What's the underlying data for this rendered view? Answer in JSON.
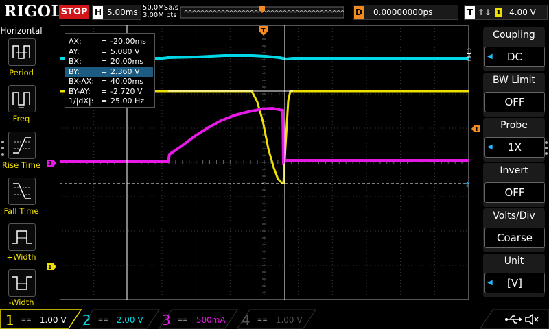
{
  "header": {
    "logo": "RIGOL",
    "run_state": "STOP",
    "timebase_tag": "H",
    "timebase": "5.00ms",
    "sample_rate": "50.0MSa/s",
    "memory_depth": "3.00M pts",
    "delay_tag": "D",
    "delay": "0.00000000ps",
    "trigger_tag": "T",
    "trigger_edge": "↑↓",
    "trigger_source": "1",
    "trigger_level": "4.00 V"
  },
  "left_menu": {
    "title": "Horizontal",
    "items": [
      {
        "label": "Period"
      },
      {
        "label": "Freq"
      },
      {
        "label": "Rise Time"
      },
      {
        "label": "Fall Time"
      },
      {
        "label": "+Width"
      },
      {
        "label": "-Width"
      }
    ]
  },
  "cursor_panel": {
    "rows": [
      {
        "key": "AX:",
        "eq": "=",
        "value": "-20.00ms"
      },
      {
        "key": "AY:",
        "eq": "=",
        "value": "5.080 V"
      },
      {
        "key": "BX:",
        "eq": "=",
        "value": "20.00ms"
      },
      {
        "key": "BY:",
        "eq": "=",
        "value": "2.360 V"
      },
      {
        "key": "BX-AX:",
        "eq": "=",
        "value": "40.00ms"
      },
      {
        "key": "BY-AY:",
        "eq": "=",
        "value": "-2.720 V"
      },
      {
        "key": "1/|dX|:",
        "eq": "=",
        "value": "25.00 Hz"
      }
    ],
    "selected_row": 3
  },
  "markers": {
    "ch1_ground": "1",
    "ch3_ground": "3",
    "trigger_pos": "T",
    "trigger_level": "T"
  },
  "right_menu": {
    "channel_tab": "CH1",
    "coupling": {
      "label": "Coupling",
      "value": "DC"
    },
    "bw_limit": {
      "label": "BW Limit",
      "value": "OFF"
    },
    "probe": {
      "label": "Probe",
      "value": "1X"
    },
    "invert": {
      "label": "Invert",
      "value": "OFF"
    },
    "volts_div": {
      "label": "Volts/Div",
      "value": "Coarse"
    },
    "unit": {
      "label": "Unit",
      "value": "[V]"
    }
  },
  "channels": [
    {
      "num": "1",
      "coupling": "==",
      "scale": "1.00 V",
      "color": "#f0e000",
      "active": true
    },
    {
      "num": "2",
      "coupling": "==",
      "scale": "2.00 V",
      "color": "#00d8e8",
      "active": false
    },
    {
      "num": "3",
      "coupling": "==",
      "scale": "500mA",
      "color": "#e619e6",
      "active": false
    },
    {
      "num": "4",
      "coupling": "==",
      "scale": "1.00 V",
      "color": "#5a7dff",
      "active": false
    }
  ],
  "colors": {
    "ch1": "#f0e000",
    "ch2": "#00d8e8",
    "ch3": "#e619e6",
    "ch4": "#5a7dff",
    "accent_blue": "#2ab6ff",
    "stop_red": "#d0151b",
    "delay_orange": "#f28a21"
  }
}
